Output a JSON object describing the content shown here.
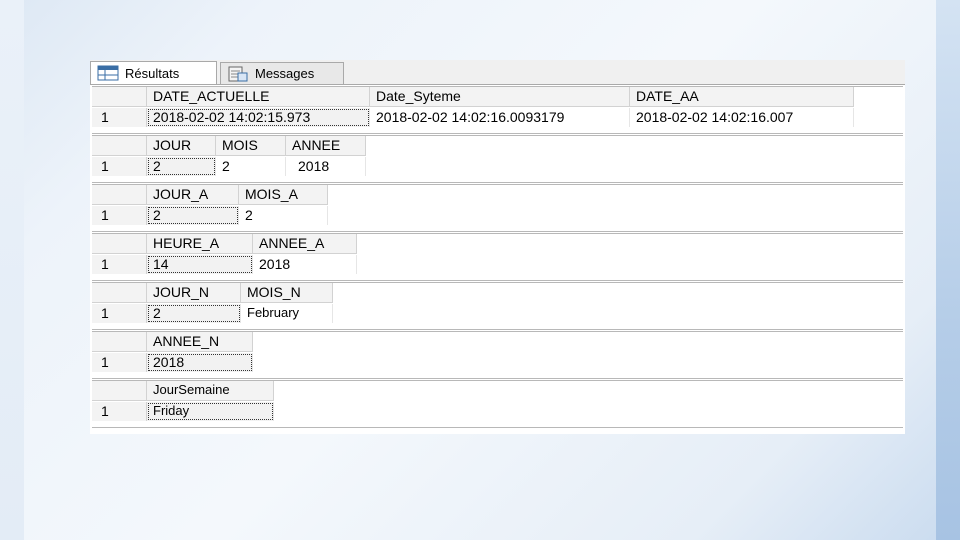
{
  "tabs": [
    {
      "label": "Résultats",
      "icon": "grid-icon",
      "active": true
    },
    {
      "label": "Messages",
      "icon": "messages-icon",
      "active": false
    }
  ],
  "grids": [
    {
      "columns": [
        "DATE_ACTUELLE",
        "Date_Syteme",
        "DATE_AA"
      ],
      "rows": [
        {
          "num": "1",
          "values": [
            "2018-02-02 14:02:15.973",
            "2018-02-02 14:02:16.0093179",
            "2018-02-02 14:02:16.007"
          ]
        }
      ]
    },
    {
      "columns": [
        "JOUR",
        "MOIS",
        "ANNEE"
      ],
      "rows": [
        {
          "num": "1",
          "values": [
            "2",
            "2",
            "2018"
          ]
        }
      ]
    },
    {
      "columns": [
        "JOUR_A",
        "MOIS_A"
      ],
      "rows": [
        {
          "num": "1",
          "values": [
            "2",
            "2"
          ]
        }
      ]
    },
    {
      "columns": [
        "HEURE_A",
        "ANNEE_A"
      ],
      "rows": [
        {
          "num": "1",
          "values": [
            "14",
            "2018"
          ]
        }
      ]
    },
    {
      "columns": [
        "JOUR_N",
        "MOIS_N"
      ],
      "rows": [
        {
          "num": "1",
          "values": [
            "2",
            "February"
          ]
        }
      ]
    },
    {
      "columns": [
        "ANNEE_N"
      ],
      "rows": [
        {
          "num": "1",
          "values": [
            "2018"
          ]
        }
      ]
    },
    {
      "columns": [
        "JourSemaine"
      ],
      "rows": [
        {
          "num": "1",
          "values": [
            "Friday"
          ]
        }
      ]
    }
  ]
}
